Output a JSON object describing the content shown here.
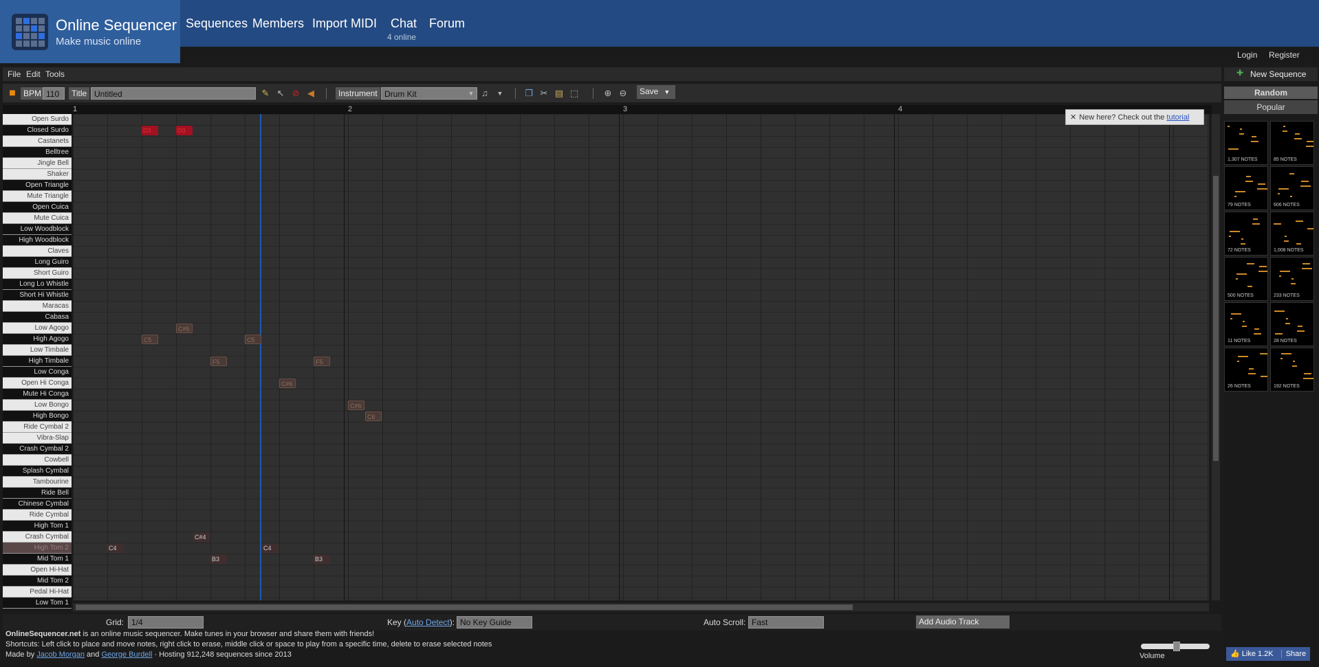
{
  "header": {
    "title": "Online Sequencer",
    "subtitle": "Make music online",
    "nav": [
      "Sequences",
      "Members",
      "Import MIDI",
      "Chat",
      "Forum"
    ],
    "chat_online": "4 online",
    "login": "Login",
    "register": "Register"
  },
  "menu": [
    "File",
    "Edit",
    "Tools"
  ],
  "toolbar": {
    "bpm_label": "BPM",
    "bpm_value": "110",
    "title_label": "Title",
    "title_value": "Untitled",
    "instrument_label": "Instrument",
    "instrument_value": "Drum Kit",
    "save_label": "Save"
  },
  "ruler": [
    "1",
    "2",
    "3",
    "4"
  ],
  "keys": [
    {
      "label": "Open Surdo",
      "type": "white"
    },
    {
      "label": "Closed Surdo",
      "type": "black"
    },
    {
      "label": "Castanets",
      "type": "white"
    },
    {
      "label": "Belltree",
      "type": "black"
    },
    {
      "label": "Jingle Bell",
      "type": "white"
    },
    {
      "label": "Shaker",
      "type": "white"
    },
    {
      "label": "Open Triangle",
      "type": "black"
    },
    {
      "label": "Mute Triangle",
      "type": "white"
    },
    {
      "label": "Open Cuica",
      "type": "black"
    },
    {
      "label": "Mute Cuica",
      "type": "white"
    },
    {
      "label": "Low Woodblock",
      "type": "black"
    },
    {
      "label": "High Woodblock",
      "type": "black"
    },
    {
      "label": "Claves",
      "type": "white"
    },
    {
      "label": "Long Guiro",
      "type": "black"
    },
    {
      "label": "Short Guiro",
      "type": "white"
    },
    {
      "label": "Long Lo Whistle",
      "type": "black"
    },
    {
      "label": "Short Hi Whistle",
      "type": "black"
    },
    {
      "label": "Maracas",
      "type": "white"
    },
    {
      "label": "Cabasa",
      "type": "black"
    },
    {
      "label": "Low Agogo",
      "type": "white"
    },
    {
      "label": "High Agogo",
      "type": "black"
    },
    {
      "label": "Low Timbale",
      "type": "white"
    },
    {
      "label": "High Timbale",
      "type": "black"
    },
    {
      "label": "Low Conga",
      "type": "black"
    },
    {
      "label": "Open Hi Conga",
      "type": "white"
    },
    {
      "label": "Mute Hi Conga",
      "type": "black"
    },
    {
      "label": "Low Bongo",
      "type": "white"
    },
    {
      "label": "High Bongo",
      "type": "black"
    },
    {
      "label": "Ride Cymbal 2",
      "type": "white"
    },
    {
      "label": "Vibra-Slap",
      "type": "white"
    },
    {
      "label": "Crash Cymbal 2",
      "type": "black"
    },
    {
      "label": "Cowbell",
      "type": "white"
    },
    {
      "label": "Splash Cymbal",
      "type": "black"
    },
    {
      "label": "Tambourine",
      "type": "white"
    },
    {
      "label": "Ride Bell",
      "type": "black"
    },
    {
      "label": "Chinese Cymbal",
      "type": "black"
    },
    {
      "label": "Ride Cymbal",
      "type": "white"
    },
    {
      "label": "High Tom 1",
      "type": "black"
    },
    {
      "label": "Crash Cymbal",
      "type": "white"
    },
    {
      "label": "High Tom 2",
      "type": "active"
    },
    {
      "label": "Mid Tom 1",
      "type": "black"
    },
    {
      "label": "Open Hi-Hat",
      "type": "white"
    },
    {
      "label": "Mid Tom 2",
      "type": "black"
    },
    {
      "label": "Pedal Hi-Hat",
      "type": "white"
    },
    {
      "label": "Low Tom 1",
      "type": "black"
    }
  ],
  "notes": [
    {
      "label": "D3",
      "row": 1,
      "col": 2,
      "style": "red"
    },
    {
      "label": "D3",
      "row": 1,
      "col": 3,
      "style": "red"
    },
    {
      "label": "C#5",
      "row": 19,
      "col": 3,
      "style": "ghost"
    },
    {
      "label": "C5",
      "row": 20,
      "col": 2,
      "style": "ghost"
    },
    {
      "label": "C5",
      "row": 20,
      "col": 5,
      "style": "ghost"
    },
    {
      "label": "F5",
      "row": 22,
      "col": 4,
      "style": "ghost"
    },
    {
      "label": "F5",
      "row": 22,
      "col": 7,
      "style": "ghost"
    },
    {
      "label": "C#6",
      "row": 24,
      "col": 6,
      "style": "ghost"
    },
    {
      "label": "C#6",
      "row": 26,
      "col": 8,
      "style": "ghost"
    },
    {
      "label": "C6",
      "row": 27,
      "col": 8.5,
      "style": "ghost"
    },
    {
      "label": "C#4",
      "row": 38,
      "col": 3.5,
      "style": "dark"
    },
    {
      "label": "C4",
      "row": 39,
      "col": 1,
      "style": "dark"
    },
    {
      "label": "C4",
      "row": 39,
      "col": 5.5,
      "style": "dark"
    },
    {
      "label": "B3",
      "row": 40,
      "col": 4,
      "style": "dark"
    },
    {
      "label": "B3",
      "row": 40,
      "col": 7,
      "style": "dark"
    }
  ],
  "tutorial": {
    "text": "New here? Check out the",
    "link": "tutorial"
  },
  "bottom": {
    "grid_label": "Grid:",
    "grid_value": "1/4",
    "key_label": "Key (",
    "key_link": "Auto Detect",
    "key_label_end": "):",
    "key_value": "No Key Guide",
    "autoscroll_label": "Auto Scroll:",
    "autoscroll_value": "Fast",
    "add_audio": "Add Audio Track"
  },
  "footer": {
    "line1_bold": "OnlineSequencer.net",
    "line1_rest": " is an online music sequencer. Make tunes in your browser and share them with friends!",
    "line2": "Shortcuts: Left click to place and move notes, right click to erase, middle click or space to play from a specific time, delete to erase selected notes",
    "made_by": "Made by ",
    "author1": "Jacob Morgan",
    "and": " and ",
    "author2": "George Burdell",
    "hosting": " · Hosting 912,248 sequences since 2013",
    "volume": "Volume"
  },
  "sidebar": {
    "new_sequence": "New Sequence",
    "random": "Random",
    "popular": "Popular",
    "thumbs": [
      "1,307 NOTES",
      "85 NOTES",
      "79 NOTES",
      "606 NOTES",
      "72 NOTES",
      "1,008 NOTES",
      "500 NOTES",
      "233 NOTES",
      "11 NOTES",
      "28 NOTES",
      "26 NOTES",
      "192 NOTES"
    ],
    "like": "Like 1.2K",
    "share": "Share"
  }
}
